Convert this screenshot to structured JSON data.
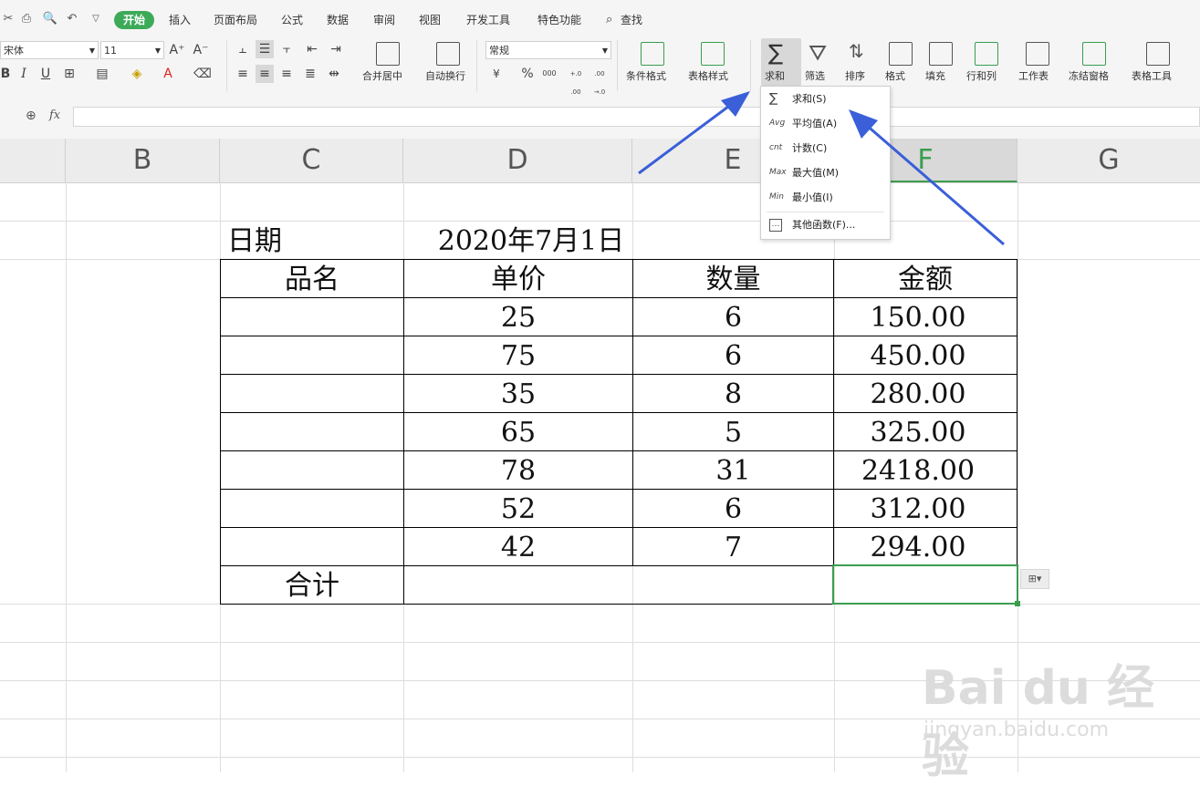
{
  "menubar": {
    "tabs": [
      "开始",
      "插入",
      "页面布局",
      "公式",
      "数据",
      "审阅",
      "视图",
      "开发工具",
      "特色功能"
    ],
    "search_label": "查找"
  },
  "ribbon": {
    "font_name": "宋体",
    "font_size": "11",
    "number_format": "常规",
    "merge_center_label": "合并居中",
    "wrap_label": "自动换行",
    "cond_format_label": "条件格式",
    "table_style_label": "表格样式",
    "sum_label": "求和",
    "filter_label": "筛选",
    "sort_label": "排序",
    "format_label": "格式",
    "fill_label": "填充",
    "rowcol_label": "行和列",
    "sheet_label": "工作表",
    "freeze_label": "冻结窗格",
    "table_tool_label": "表格工具",
    "percent_symbol": "%",
    "thousands_symbol": "000",
    "currency_symbol": "¥",
    "inc_decimal": "+.0 .00",
    "dec_decimal": ".00 →.0"
  },
  "formula_bar": {
    "fx_label": "fx",
    "value": ""
  },
  "columns": [
    "B",
    "C",
    "D",
    "E",
    "F",
    "G"
  ],
  "sheet": {
    "date_label": "日期",
    "date_value": "2020年7月1日",
    "headers": [
      "品名",
      "单价",
      "数量",
      "金额"
    ],
    "rows": [
      {
        "name": "",
        "price": "25",
        "qty": "6",
        "amount": "150.00"
      },
      {
        "name": "",
        "price": "75",
        "qty": "6",
        "amount": "450.00"
      },
      {
        "name": "",
        "price": "35",
        "qty": "8",
        "amount": "280.00"
      },
      {
        "name": "",
        "price": "65",
        "qty": "5",
        "amount": "325.00"
      },
      {
        "name": "",
        "price": "78",
        "qty": "31",
        "amount": "2418.00"
      },
      {
        "name": "",
        "price": "52",
        "qty": "6",
        "amount": "312.00"
      },
      {
        "name": "",
        "price": "42",
        "qty": "7",
        "amount": "294.00"
      }
    ],
    "total_label": "合计",
    "total_value": ""
  },
  "dropdown": {
    "items": [
      {
        "icon": "∑",
        "label": "求和(S)"
      },
      {
        "icon": "Avg",
        "label": "平均值(A)"
      },
      {
        "icon": "cnt",
        "label": "计数(C)"
      },
      {
        "icon": "Max",
        "label": "最大值(M)"
      },
      {
        "icon": "Min",
        "label": "最小值(I)"
      },
      {
        "icon": "…",
        "label": "其他函数(F)..."
      }
    ]
  },
  "colors": {
    "accent_green": "#3daa5a",
    "selection_green": "#3a9e4f",
    "arrow_blue": "#3a5fd8"
  },
  "watermark": {
    "main": "Bai du 经验",
    "sub": "jingyan.baidu.com"
  }
}
